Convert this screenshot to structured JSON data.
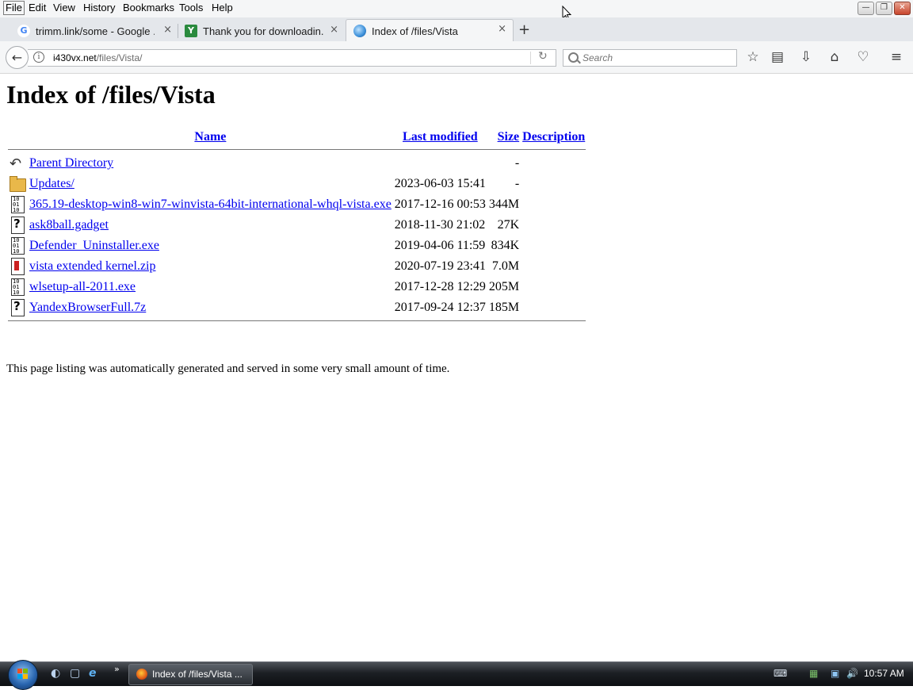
{
  "menu": [
    "File",
    "Edit",
    "View",
    "History",
    "Bookmarks",
    "Tools",
    "Help"
  ],
  "window_controls": {
    "minimize": "—",
    "restore": "❐",
    "close": "✕"
  },
  "tabs": [
    {
      "label": "trimm.link/some - Google ...",
      "favicon": "G",
      "favicon_color": "#4285f4"
    },
    {
      "label": "Thank you for downloadin...",
      "favicon": "Y",
      "favicon_color": "#2a8a3e"
    },
    {
      "label": "Index of /files/Vista",
      "favicon": "globe",
      "favicon_color": "#3b8fd9"
    }
  ],
  "tab_close": "×",
  "new_tab": "+",
  "nav": {
    "back": "←",
    "url_host": "i430vx.net",
    "url_path": "/files/Vista/",
    "reload": "↻",
    "search_placeholder": "Search"
  },
  "toolbar_icons": [
    "☆",
    "▤",
    "⇩",
    "⌂",
    "♡",
    "≡"
  ],
  "page": {
    "title": "Index of /files/Vista",
    "columns": {
      "name": "Name",
      "modified": "Last modified",
      "size": "Size",
      "description": "Description"
    },
    "rows": [
      {
        "icon": "back",
        "name": "Parent Directory",
        "modified": "",
        "size": "-"
      },
      {
        "icon": "folder",
        "name": "Updates/",
        "modified": "2023-06-03 15:41",
        "size": "-"
      },
      {
        "icon": "binary",
        "name": "365.19-desktop-win8-win7-winvista-64bit-international-whql-vista.exe",
        "modified": "2017-12-16 00:53",
        "size": "344M"
      },
      {
        "icon": "unknown",
        "name": "ask8ball.gadget",
        "modified": "2018-11-30 21:02",
        "size": "27K"
      },
      {
        "icon": "binary",
        "name": "Defender_Uninstaller.exe",
        "modified": "2019-04-06 11:59",
        "size": "834K"
      },
      {
        "icon": "compressed",
        "name": "vista extended kernel.zip",
        "modified": "2020-07-19 23:41",
        "size": "7.0M"
      },
      {
        "icon": "binary",
        "name": "wlsetup-all-2011.exe",
        "modified": "2017-12-28 12:29",
        "size": "205M"
      },
      {
        "icon": "unknown",
        "name": "YandexBrowserFull.7z",
        "modified": "2017-09-24 12:37",
        "size": "185M"
      }
    ],
    "footer": "This page listing was automatically generated and served in some very small amount of time."
  },
  "taskbar": {
    "task_label": "Index of /files/Vista ...",
    "quicklaunch": [
      "◐",
      "▢",
      "e"
    ],
    "quicklaunch_more": "»",
    "tray": [
      "⌨",
      "▦",
      "▣",
      "🔊"
    ],
    "clock": "10:57 AM"
  }
}
